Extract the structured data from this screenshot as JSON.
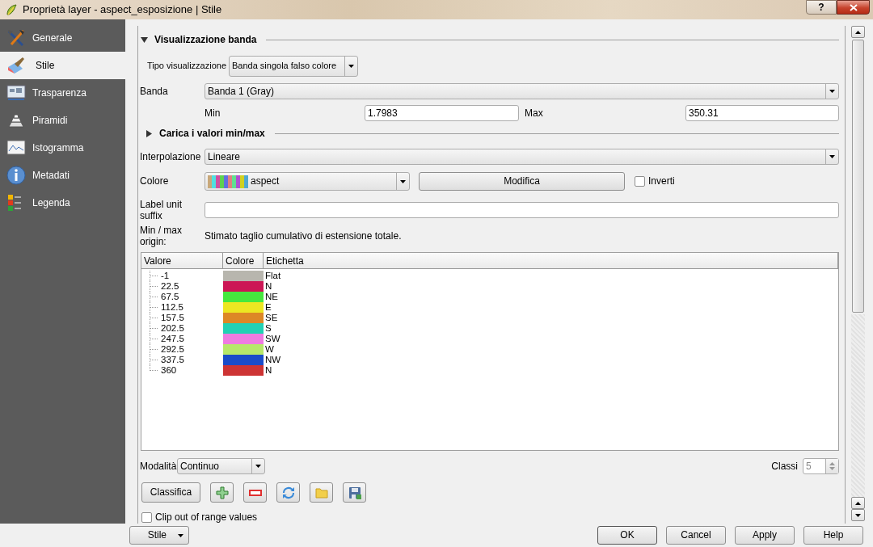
{
  "window": {
    "title": "Proprietà layer - aspect_esposizione | Stile",
    "help_button": "?"
  },
  "sidebar": {
    "items": [
      {
        "label": "Generale",
        "selected": false,
        "kind": "tools"
      },
      {
        "label": "Stile",
        "selected": true,
        "kind": "brush"
      },
      {
        "label": "Trasparenza",
        "selected": false,
        "kind": "map"
      },
      {
        "label": "Piramidi",
        "selected": false,
        "kind": "layers"
      },
      {
        "label": "Istogramma",
        "selected": false,
        "kind": "chart"
      },
      {
        "label": "Metadati",
        "selected": false,
        "kind": "info"
      },
      {
        "label": "Legenda",
        "selected": false,
        "kind": "legend"
      }
    ]
  },
  "band_rendering": {
    "title": "Visualizzazione banda",
    "expanded": true,
    "render_type": {
      "label": "Tipo visualizzazione",
      "value": "Banda singola falso colore"
    },
    "band": {
      "label": "Banda",
      "value": "Banda 1 (Gray)"
    },
    "min": {
      "label": "Min",
      "value": "1.7983"
    },
    "max": {
      "label": "Max",
      "value": "350.31"
    }
  },
  "minmax_section": {
    "title": "Carica i valori min/max",
    "expanded": false
  },
  "interpolation": {
    "label": "Interpolazione",
    "value": "Lineare"
  },
  "color_ramp": {
    "label": "Colore",
    "value": "aspect",
    "edit_button": "Modifica",
    "invert": {
      "label": "Inverti",
      "checked": false
    }
  },
  "label_unit_suffix": {
    "label": "Label unit suffix"
  },
  "minmax_origin": {
    "label": "Min / max origin:",
    "value": "Stimato taglio cumulativo di estensione totale."
  },
  "table": {
    "columns": [
      "Valore",
      "Colore",
      "Etichetta"
    ],
    "rows": [
      {
        "value": "-1",
        "color": "#b8b6ae",
        "label": "Flat"
      },
      {
        "value": "22.5",
        "color": "#cc1655",
        "label": "N"
      },
      {
        "value": "67.5",
        "color": "#46e83e",
        "label": "NE"
      },
      {
        "value": "112.5",
        "color": "#ece722",
        "label": "E"
      },
      {
        "value": "157.5",
        "color": "#dd8826",
        "label": "SE"
      },
      {
        "value": "202.5",
        "color": "#22d1b4",
        "label": "S"
      },
      {
        "value": "247.5",
        "color": "#ef7be1",
        "label": "SW"
      },
      {
        "value": "292.5",
        "color": "#b7e86a",
        "label": "W"
      },
      {
        "value": "337.5",
        "color": "#1a4cc9",
        "label": "NW"
      },
      {
        "value": "360",
        "color": "#cd3434",
        "label": "N"
      }
    ]
  },
  "mode": {
    "label": "Modalità",
    "value": "Continuo"
  },
  "classes": {
    "label": "Classi",
    "value": "5",
    "disabled": true
  },
  "classify_button": "Classifica",
  "tool_buttons": [
    {
      "kind": "add"
    },
    {
      "kind": "remove"
    },
    {
      "kind": "refresh"
    },
    {
      "kind": "open"
    },
    {
      "kind": "save"
    }
  ],
  "clip": {
    "label": "Clip out of range values",
    "checked": false
  },
  "footer": {
    "style_button": "Stile",
    "buttons": [
      "OK",
      "Cancel",
      "Apply",
      "Help"
    ]
  }
}
